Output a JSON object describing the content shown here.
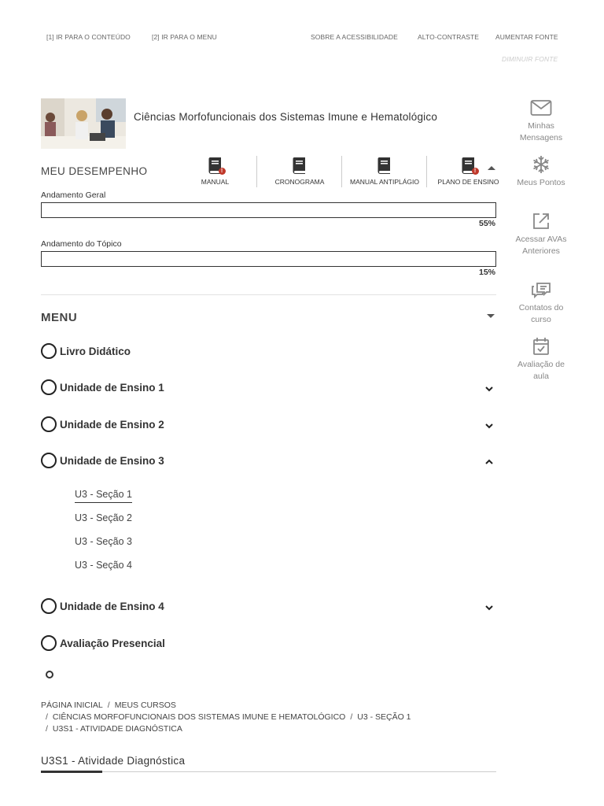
{
  "accessibility": {
    "skip_content": "[1] IR PARA O CONTEÚDO",
    "skip_menu": "[2] IR PARA O MENU",
    "about": "SOBRE A ACESSIBILIDADE",
    "contrast": "ALTO-CONTRASTE",
    "increase_font": "AUMENTAR FONTE",
    "decrease_font": "DIMINUIR FONTE"
  },
  "course": {
    "title": "Ciências Morfofuncionais dos Sistemas Imune e Hematológico"
  },
  "performance": {
    "title": "MEU DESEMPENHO",
    "tools": [
      {
        "label": "MANUAL",
        "icon": "book-icon",
        "alert": true
      },
      {
        "label": "CRONOGRAMA",
        "icon": "book-icon",
        "alert": false
      },
      {
        "label": "MANUAL ANTIPLÁGIO",
        "icon": "book-icon",
        "alert": false
      },
      {
        "label": "PLANO DE ENSINO",
        "icon": "book-icon",
        "alert": true
      }
    ],
    "general": {
      "label": "Andamento Geral",
      "percent": "55%",
      "value": 0.55
    },
    "topic": {
      "label": "Andamento do Tópico",
      "percent": "15%",
      "value": 0.15
    }
  },
  "menu": {
    "title": "MENU",
    "items": [
      {
        "label": "Livro Didático",
        "expandable": false
      },
      {
        "label": "Unidade de Ensino 1",
        "expandable": true,
        "expanded": false
      },
      {
        "label": "Unidade de Ensino 2",
        "expandable": true,
        "expanded": false
      },
      {
        "label": "Unidade de Ensino 3",
        "expandable": true,
        "expanded": true
      },
      {
        "label": "Unidade de Ensino 4",
        "expandable": true,
        "expanded": false
      },
      {
        "label": "Avaliação Presencial",
        "expandable": false
      }
    ],
    "sub_items": [
      "U3 - Seção 1",
      "U3 - Seção 2",
      "U3 - Seção 3",
      "U3 - Seção 4"
    ],
    "active_sub": "U3 - Seção 1"
  },
  "breadcrumb": {
    "home": "PÁGINA INICIAL",
    "courses": "MEUS CURSOS",
    "course": "CIÊNCIAS MORFOFUNCIONAIS DOS SISTEMAS IMUNE E HEMATOLÓGICO",
    "section": "U3 - SEÇÃO 1",
    "activity": "U3S1 - ATIVIDADE DIAGNÓSTICA"
  },
  "page": {
    "heading": "U3S1 - Atividade Diagnóstica"
  },
  "rail": {
    "messages": "Minhas Mensagens",
    "points": "Meus Pontos",
    "previous": "Acessar AVAs Anteriores",
    "contacts": "Contatos do curso",
    "evaluation": "Avaliação de aula"
  },
  "colors": {
    "text": "#333333",
    "muted": "#888888",
    "alert": "#c0392b"
  }
}
